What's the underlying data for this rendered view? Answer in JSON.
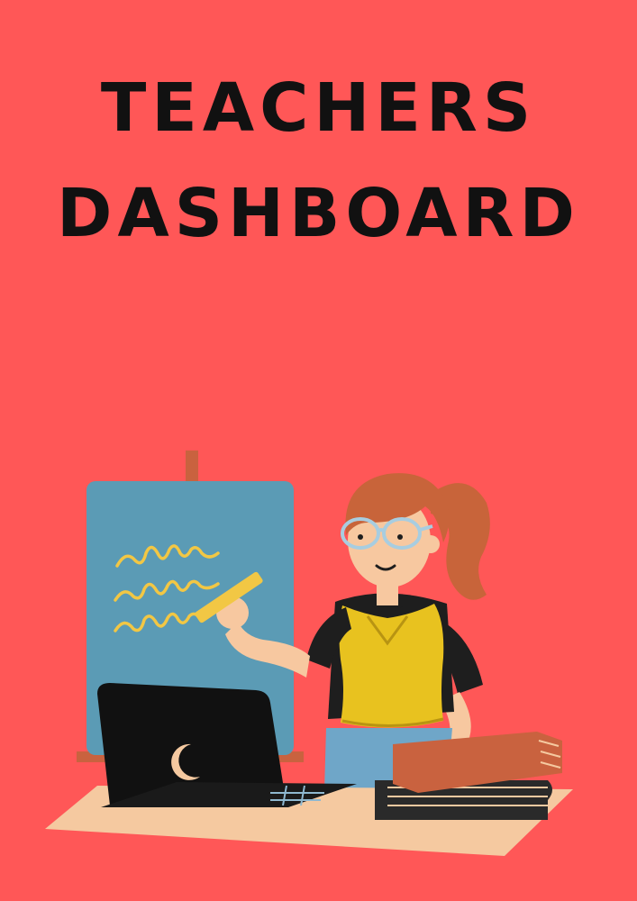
{
  "poster": {
    "title_line_1": "TEACHERS",
    "title_line_2": "DASHBOARD"
  },
  "colors": {
    "background": "#ff5757",
    "title": "#111111",
    "board": "#5b9bb5",
    "chalk": "#f2c744",
    "vest": "#e8c21f",
    "skin": "#f7c8a0",
    "hair": "#c8643a",
    "laptop": "#111111",
    "desk": "#f5c9a0",
    "book_top": "#c9623f",
    "book_bottom": "#2a2a2a"
  },
  "illustration": {
    "name": "teacher-at-chalkboard-illustration",
    "elements": [
      "easel",
      "chalkboard",
      "teacher",
      "laptop",
      "moon-logo",
      "desk",
      "book-stack"
    ]
  }
}
